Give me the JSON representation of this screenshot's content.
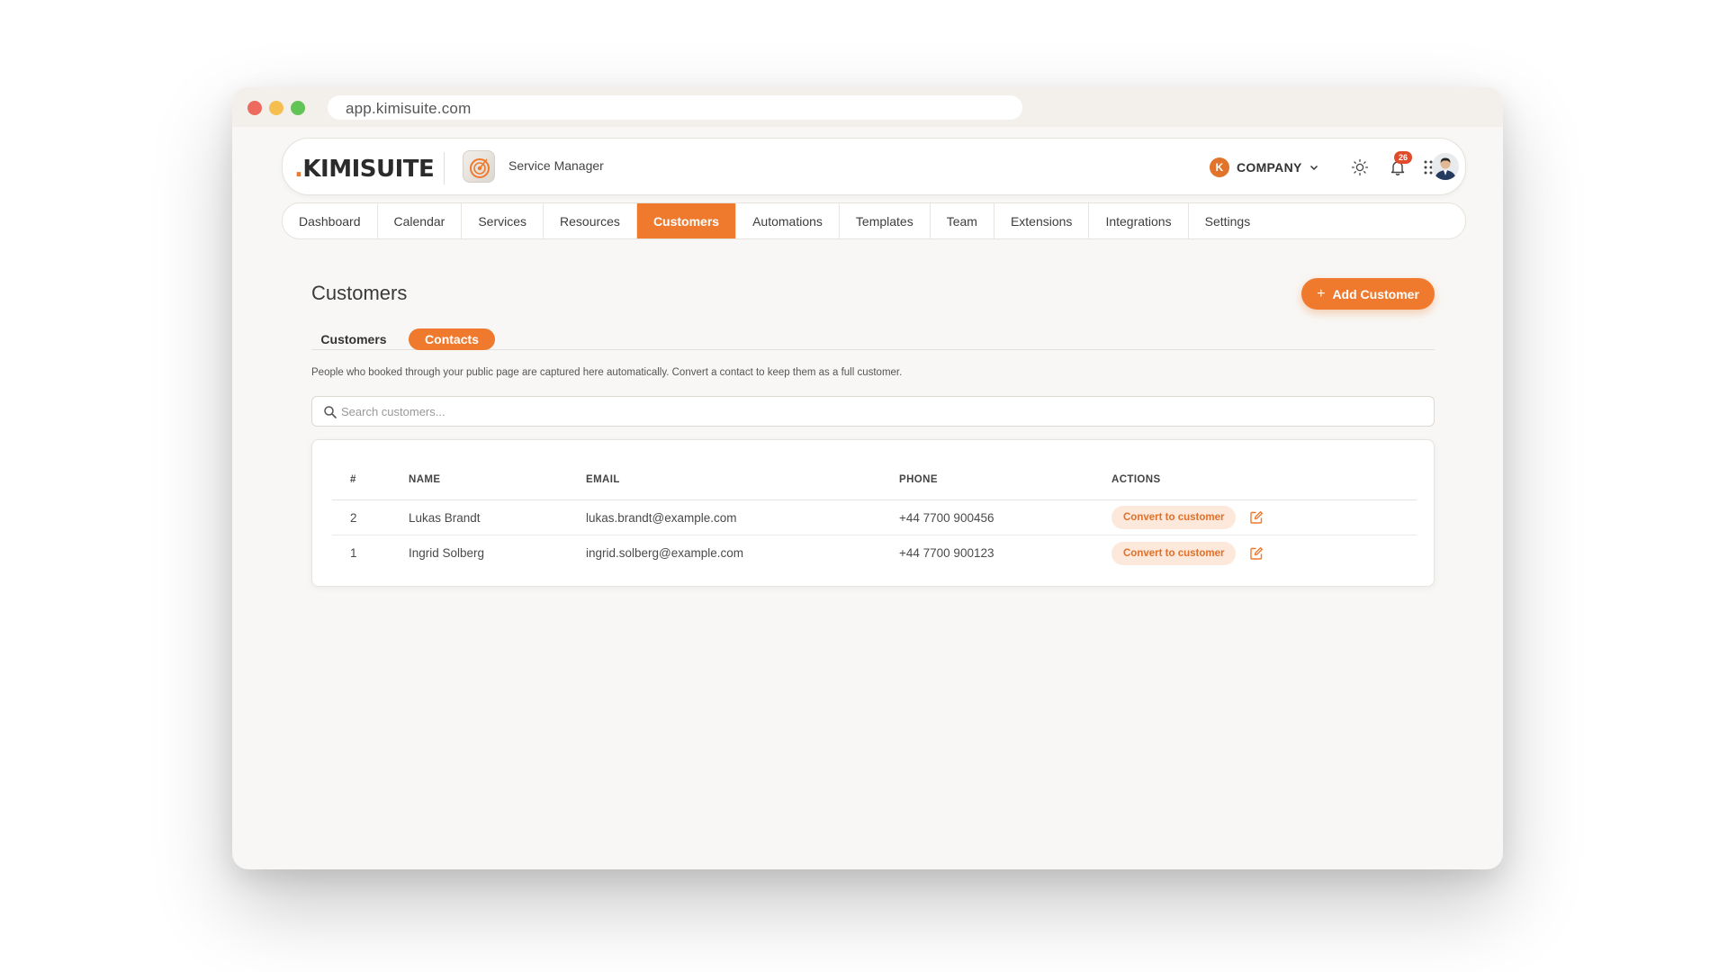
{
  "browser": {
    "url": "app.kimisuite.com"
  },
  "header": {
    "logo_dot": ".",
    "logo_text": "KIMISUITE",
    "app_name": "Service Manager",
    "company_initial": "K",
    "company_label": "COMPANY",
    "notification_count": "26",
    "icons": [
      "sun-icon",
      "bell-icon",
      "apps-grid-icon",
      "avatar"
    ]
  },
  "nav": {
    "items": [
      {
        "label": "Dashboard",
        "active": false
      },
      {
        "label": "Calendar",
        "active": false
      },
      {
        "label": "Services",
        "active": false
      },
      {
        "label": "Resources",
        "active": false
      },
      {
        "label": "Customers",
        "active": true
      },
      {
        "label": "Automations",
        "active": false
      },
      {
        "label": "Templates",
        "active": false
      },
      {
        "label": "Team",
        "active": false
      },
      {
        "label": "Extensions",
        "active": false
      },
      {
        "label": "Integrations",
        "active": false
      },
      {
        "label": "Settings",
        "active": false
      }
    ]
  },
  "page": {
    "title": "Customers",
    "add_button": "Add Customer",
    "subtabs": {
      "customers": "Customers",
      "contacts": "Contacts",
      "active": "Contacts"
    },
    "description": "People who booked through your public page are captured here automatically. Convert a contact to keep them as a full customer.",
    "search_placeholder": "Search customers..."
  },
  "table": {
    "headers": {
      "num": "#",
      "name": "NAME",
      "email": "EMAIL",
      "phone": "PHONE",
      "actions": "ACTIONS"
    },
    "rows": [
      {
        "num": "2",
        "name": "Lukas Brandt",
        "email": "lukas.brandt@example.com",
        "phone": "+44 7700 900456",
        "action": "Convert to customer"
      },
      {
        "num": "1",
        "name": "Ingrid Solberg",
        "email": "ingrid.solberg@example.com",
        "phone": "+44 7700 900123",
        "action": "Convert to customer"
      }
    ]
  },
  "colors": {
    "accent": "#ef7a2d",
    "accent_soft": "#fde9dc",
    "badge_red": "#e04b2b"
  }
}
